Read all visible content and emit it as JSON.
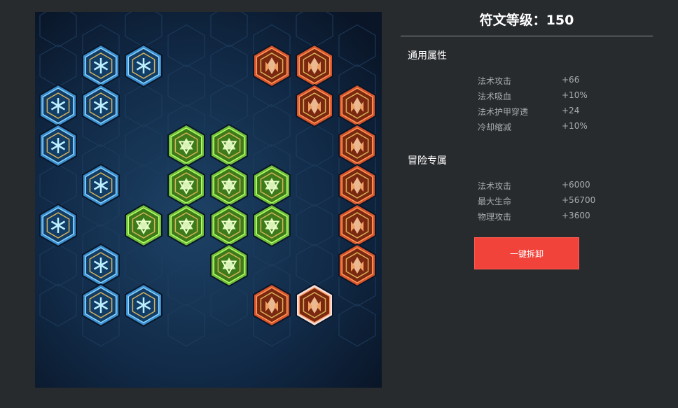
{
  "panel": {
    "title": "符文等级：150",
    "general": {
      "heading": "通用属性",
      "attrs": [
        {
          "name": "法术攻击",
          "value": "+66"
        },
        {
          "name": "法术吸血",
          "value": "+10%"
        },
        {
          "name": "法术护甲穿透",
          "value": "+24"
        },
        {
          "name": "冷却缩减",
          "value": "+10%"
        }
      ]
    },
    "adventure": {
      "heading": "冒险专属",
      "attrs": [
        {
          "name": "法术攻击",
          "value": "+6000"
        },
        {
          "name": "最大生命",
          "value": "+56700"
        },
        {
          "name": "物理攻击",
          "value": "+3600"
        }
      ]
    },
    "unequip_button": "一键拆卸"
  },
  "board": {
    "colors": {
      "blue": "#2f7fb8",
      "green": "#58a832",
      "red": "#c0451e",
      "background": "#0f2540"
    },
    "runes": [
      {
        "color": "blue",
        "icon": "blue-snowflake-icon"
      },
      {
        "color": "blue",
        "icon": "blue-snowflake-icon"
      },
      {
        "color": "blue",
        "icon": "blue-snowflake-icon"
      },
      {
        "color": "blue",
        "icon": "blue-snowflake-icon"
      },
      {
        "color": "blue",
        "icon": "blue-snowflake-icon"
      },
      {
        "color": "blue",
        "icon": "blue-snowflake-icon"
      },
      {
        "color": "blue",
        "icon": "blue-snowflake-icon"
      },
      {
        "color": "blue",
        "icon": "blue-snowflake-icon"
      },
      {
        "color": "blue",
        "icon": "blue-snowflake-icon"
      },
      {
        "color": "blue",
        "icon": "blue-snowflake-icon"
      },
      {
        "color": "green",
        "icon": "green-star-icon"
      },
      {
        "color": "green",
        "icon": "green-star-icon"
      },
      {
        "color": "green",
        "icon": "green-star-icon"
      },
      {
        "color": "green",
        "icon": "green-star-icon"
      },
      {
        "color": "green",
        "icon": "green-star-icon"
      },
      {
        "color": "green",
        "icon": "green-star-icon"
      },
      {
        "color": "green",
        "icon": "green-star-icon"
      },
      {
        "color": "green",
        "icon": "green-star-icon"
      },
      {
        "color": "green",
        "icon": "green-star-icon"
      },
      {
        "color": "green",
        "icon": "green-star-icon"
      },
      {
        "color": "red",
        "icon": "red-crystal-icon"
      },
      {
        "color": "red",
        "icon": "red-crystal-icon"
      },
      {
        "color": "red",
        "icon": "red-crystal-icon"
      },
      {
        "color": "red",
        "icon": "red-crystal-icon"
      },
      {
        "color": "red",
        "icon": "red-crystal-icon"
      },
      {
        "color": "red",
        "icon": "red-crystal-icon"
      },
      {
        "color": "red",
        "icon": "red-crystal-icon"
      },
      {
        "color": "red",
        "icon": "red-crystal-icon"
      },
      {
        "color": "red",
        "icon": "red-crystal-icon"
      },
      {
        "color": "red",
        "icon": "red-crystal-icon",
        "selected": true
      }
    ]
  }
}
